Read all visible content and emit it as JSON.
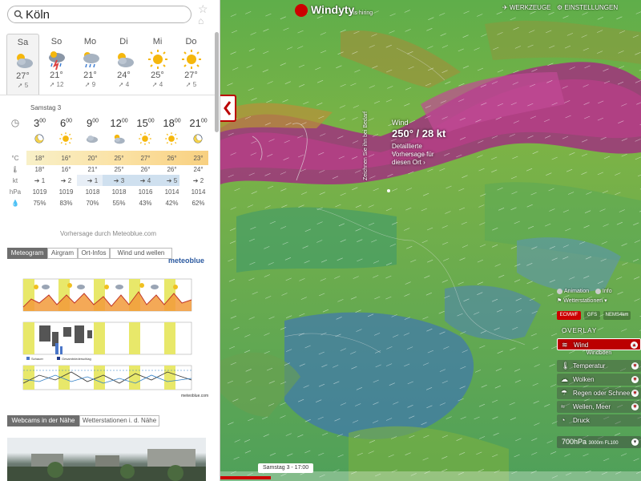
{
  "search": {
    "value": "Köln"
  },
  "days": [
    {
      "name": "Sa",
      "icon": "cloudy-sun-icon",
      "temp": "27°",
      "wind": "5",
      "selected": true
    },
    {
      "name": "So",
      "icon": "thunderstorm-icon",
      "temp": "21°",
      "wind": "12"
    },
    {
      "name": "Mo",
      "icon": "cloudy-rain-icon",
      "temp": "21°",
      "wind": "9"
    },
    {
      "name": "Di",
      "icon": "cloudy-sun-icon",
      "temp": "24°",
      "wind": "4"
    },
    {
      "name": "Mi",
      "icon": "sun-icon",
      "temp": "25°",
      "wind": "4"
    },
    {
      "name": "Do",
      "icon": "sun-icon",
      "temp": "27°",
      "wind": "5"
    }
  ],
  "day_detail": {
    "title": "Samstag 3",
    "row_labels": {
      "temp": "°C",
      "wind": "kt",
      "pressure": "hPa",
      "humidity": "%"
    },
    "hours": [
      {
        "h": "3",
        "icon": "moon-icon",
        "temp": "18°",
        "dew": "18°",
        "wind": "1",
        "pressure": "1019",
        "humidity": "75%"
      },
      {
        "h": "6",
        "icon": "sun-icon",
        "temp": "16°",
        "dew": "16°",
        "wind": "2",
        "pressure": "1019",
        "humidity": "83%"
      },
      {
        "h": "9",
        "icon": "cloud-icon",
        "temp": "20°",
        "dew": "21°",
        "wind": "1",
        "pressure": "1018",
        "humidity": "70%"
      },
      {
        "h": "12",
        "icon": "cloudy-sun-icon",
        "temp": "25°",
        "dew": "25°",
        "wind": "3",
        "pressure": "1018",
        "humidity": "55%"
      },
      {
        "h": "15",
        "icon": "sun-icon",
        "temp": "27°",
        "dew": "26°",
        "wind": "4",
        "pressure": "1016",
        "humidity": "43%"
      },
      {
        "h": "18",
        "icon": "sun-icon",
        "temp": "26°",
        "dew": "26°",
        "wind": "5",
        "pressure": "1014",
        "humidity": "42%"
      },
      {
        "h": "21",
        "icon": "moon-icon",
        "temp": "23°",
        "dew": "24°",
        "wind": "2",
        "pressure": "1014",
        "humidity": "62%"
      }
    ],
    "hour_suffix": "00"
  },
  "credit": "Vorhersage durch Meteoblue.com",
  "tabs": [
    "Meteogram",
    "Airgram",
    "Ort-Infos",
    "Wind und wellen"
  ],
  "meteogram": {
    "logo": "meteoblue",
    "credit": "meteoblue.com",
    "legend_precip": "Schauer",
    "legend_total": "Gesamtniederschlag"
  },
  "tabs2": [
    "Webcams in der Nähe",
    "Wetterstationen i. d. Nähe"
  ],
  "map": {
    "logo": "Windyty",
    "hiring": "is hiring",
    "tools": "WERKZEUGE",
    "settings": "EINSTELLUNGEN",
    "popup": {
      "label": "Wind",
      "value": "250° / 28 kt",
      "link": "Detaillierte Vorhersage für diesen Ort"
    },
    "vertical_label": "Zeichnen Sie ihn bei Bedarf",
    "animation": "Animation",
    "info": "Info",
    "stations": "Wetterstationen",
    "models": [
      "ECMWF",
      "GFS",
      "NEMS4km"
    ],
    "overlay_header": "OVERLAY",
    "overlays": [
      {
        "label": "Wind",
        "icon": "wind-icon",
        "active": true
      },
      {
        "label": "Temperatur",
        "icon": "thermometer-icon"
      },
      {
        "label": "Wolken",
        "icon": "cloud-icon"
      },
      {
        "label": "Regen oder Schnee",
        "icon": "rain-icon"
      },
      {
        "label": "Wellen, Meer",
        "icon": "waves-icon"
      },
      {
        "label": "Druck",
        "icon": "pressure-icon"
      }
    ],
    "overlay_sub": "Windböen",
    "level": "700hPa",
    "level_small": "3000m FL100",
    "timeline": "Samstag 3 - 17:00",
    "timeline_progress": 0.12
  }
}
